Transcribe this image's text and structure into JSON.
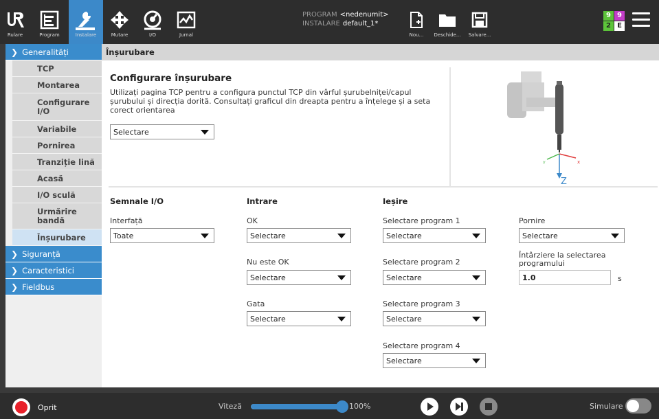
{
  "topbar": {
    "nav": [
      {
        "label": "Rulare",
        "icon": "ur-logo-icon"
      },
      {
        "label": "Program",
        "icon": "program-icon"
      },
      {
        "label": "Instalare",
        "icon": "installation-icon"
      },
      {
        "label": "Mutare",
        "icon": "move-icon"
      },
      {
        "label": "I/O",
        "icon": "io-icon"
      },
      {
        "label": "Jurnal",
        "icon": "log-icon"
      }
    ],
    "program_label": "PROGRAM",
    "program_value": "<nedenumit>",
    "installation_label": "INSTALARE",
    "installation_value": "default_1*",
    "file_actions": [
      {
        "label": "Nou...",
        "icon": "new-file-icon"
      },
      {
        "label": "Deschide...",
        "icon": "folder-icon"
      },
      {
        "label": "Salvare...",
        "icon": "save-icon"
      }
    ],
    "safety": {
      "tl": "9",
      "tr": "9",
      "bl": "2",
      "br": "E",
      "color_green": "#5cc33a",
      "color_purple": "#c23ec8"
    }
  },
  "sidebar": {
    "sections": [
      {
        "label": "Generalități",
        "expanded": true
      },
      {
        "label": "Siguranță",
        "expanded": false
      },
      {
        "label": "Caracteristici",
        "expanded": false
      },
      {
        "label": "Fieldbus",
        "expanded": false
      }
    ],
    "items": [
      {
        "label": "TCP"
      },
      {
        "label": "Montarea"
      },
      {
        "label": "Configurare I/O"
      },
      {
        "label": "Variabile"
      },
      {
        "label": "Pornirea"
      },
      {
        "label": "Tranziție lină"
      },
      {
        "label": "Acasă"
      },
      {
        "label": "I/O sculă"
      },
      {
        "label": "Urmărire bandă"
      },
      {
        "label": "Înșurubare"
      }
    ],
    "active_item": "Înșurubare"
  },
  "content": {
    "title": "Înșurubare",
    "config": {
      "title": "Configurare înșurubare",
      "description": "Utilizați pagina TCP pentru a configura punctul TCP din vârful șurubelniței/capul șurubului și direcția dorită. Consultați graficul din dreapta pentru a înțelege și a seta corect orientarea",
      "select_value": "Selectare"
    },
    "graphic": {
      "axis_z": "Z",
      "axis_x": "x",
      "axis_y": "Y"
    },
    "io": {
      "signals_header": "Semnale I/O",
      "input_header": "Intrare",
      "output_header": "Ieșire",
      "interface_label": "Interfață",
      "interface_value": "Toate",
      "ok_label": "OK",
      "ok_value": "Selectare",
      "not_ok_label": "Nu este OK",
      "not_ok_value": "Selectare",
      "done_label": "Gata",
      "done_value": "Selectare",
      "program_selects": [
        {
          "label": "Selectare program 1",
          "value": "Selectare"
        },
        {
          "label": "Selectare program 2",
          "value": "Selectare"
        },
        {
          "label": "Selectare program 3",
          "value": "Selectare"
        },
        {
          "label": "Selectare program 4",
          "value": "Selectare"
        }
      ],
      "start_label": "Pornire",
      "start_value": "Selectare",
      "delay_label": "Întârziere la selectarea programului",
      "delay_value": "1.0",
      "delay_unit": "s"
    }
  },
  "bottombar": {
    "status": "Oprit",
    "speed_label": "Viteză",
    "speed_value": "100%",
    "speed_fraction": 1.0,
    "simulation_label": "Simulare",
    "accent": "#3c89c9"
  }
}
